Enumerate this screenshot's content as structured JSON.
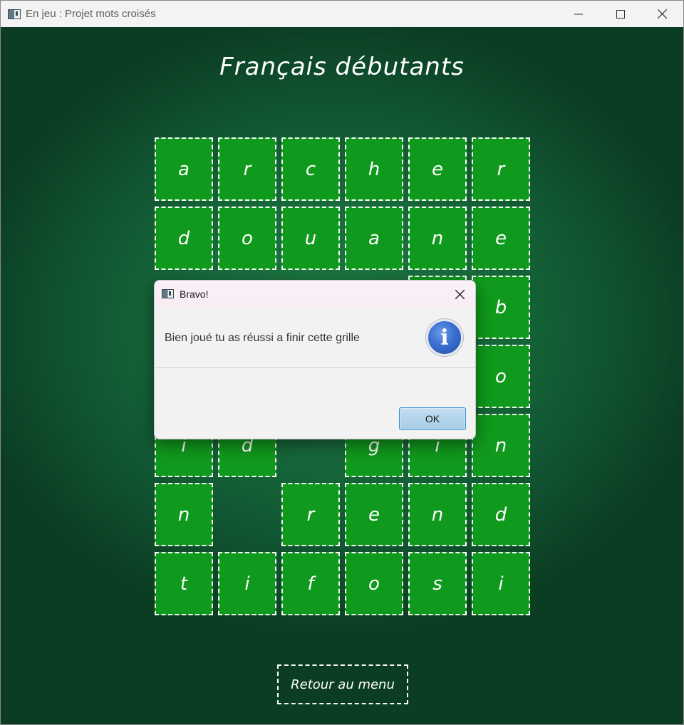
{
  "window": {
    "title": "En jeu : Projet mots croisés"
  },
  "game": {
    "title": "Français débutants",
    "grid": [
      [
        "a",
        "r",
        "c",
        "h",
        "e",
        "r"
      ],
      [
        "d",
        "o",
        "u",
        "a",
        "n",
        "e"
      ],
      [
        "",
        "",
        "",
        "",
        "",
        "b"
      ],
      [
        "",
        "",
        "",
        "",
        "",
        "o"
      ],
      [
        "i",
        "d",
        "",
        "g",
        "i",
        "n"
      ],
      [
        "n",
        "",
        "r",
        "e",
        "n",
        "d"
      ],
      [
        "t",
        "i",
        "f",
        "o",
        "s",
        "i"
      ]
    ],
    "menu_button": "Retour au menu"
  },
  "dialog": {
    "title": "Bravo!",
    "message": "Bien joué tu as réussi a finir cette grille",
    "ok_label": "OK",
    "icon": "info-icon"
  },
  "colors": {
    "cell_green": "#109a1d",
    "board_green": "#176a3b",
    "ok_blue": "#a7cce6"
  }
}
